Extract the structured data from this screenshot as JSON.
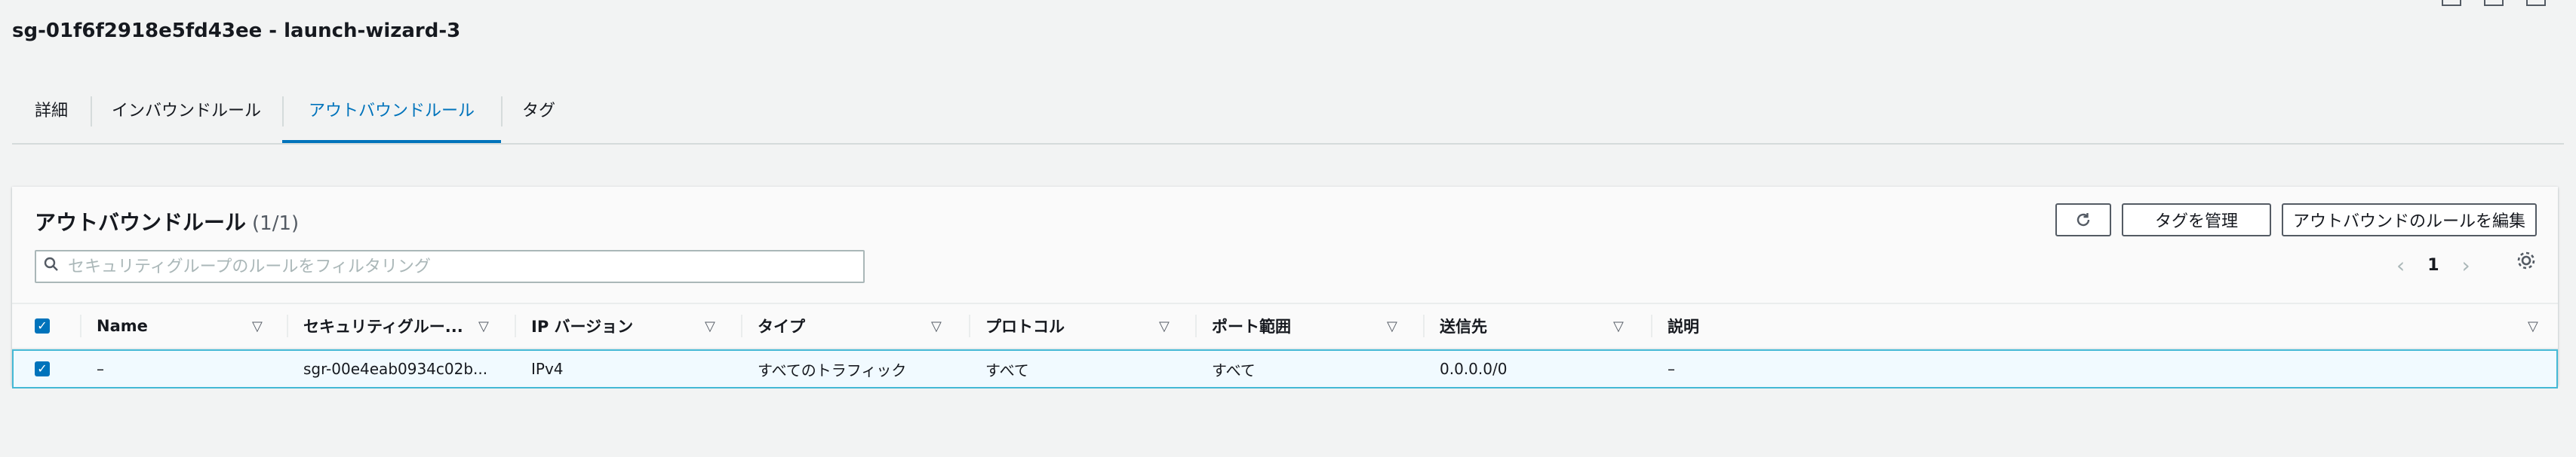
{
  "page": {
    "title": "sg-01f6f2918e5fd43ee - launch-wizard-3"
  },
  "tabs": [
    {
      "label": "詳細"
    },
    {
      "label": "インバウンドルール"
    },
    {
      "label": "アウトバウンドルール"
    },
    {
      "label": "タグ"
    }
  ],
  "panel": {
    "title": "アウトバウンドルール",
    "count": "(1/1)",
    "buttons": {
      "refresh_icon": "refresh-icon",
      "manage_tags": "タグを管理",
      "edit_rules": "アウトバウンドのルールを編集"
    },
    "search": {
      "placeholder": "セキュリティグループのルールをフィルタリング"
    },
    "pagination": {
      "prev": "‹",
      "page": "1",
      "next": "›"
    }
  },
  "table": {
    "columns": [
      "Name",
      "セキュリティグルー...",
      "IP バージョン",
      "タイプ",
      "プロトコル",
      "ポート範囲",
      "送信先",
      "説明"
    ],
    "rows": [
      {
        "name": "–",
        "sgr": "sgr-00e4eab0934c02b...",
        "ip_version": "IPv4",
        "type": "すべてのトラフィック",
        "protocol": "すべて",
        "port_range": "すべて",
        "destination": "0.0.0.0/0",
        "description": "–"
      }
    ]
  },
  "colors": {
    "accent": "#0073bb",
    "selected_row_bg": "#f1faff",
    "selected_row_border": "#44b9d6"
  }
}
